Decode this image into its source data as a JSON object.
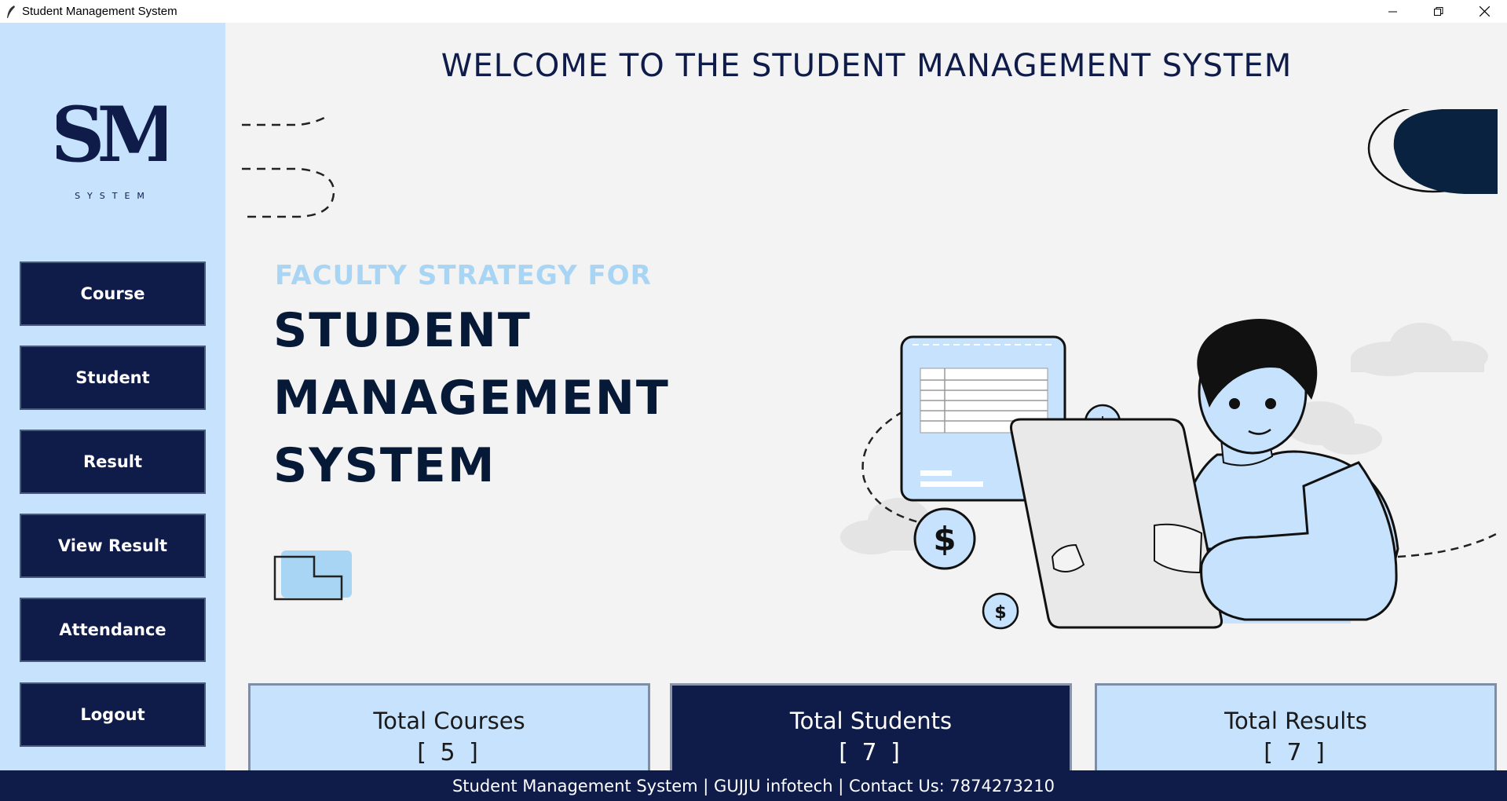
{
  "window": {
    "title": "Student Management System",
    "icon": "feather-icon"
  },
  "sidebar": {
    "logo_text": "SM",
    "logo_subtext": "SYSTEM",
    "buttons": [
      {
        "label": "Course"
      },
      {
        "label": "Student"
      },
      {
        "label": "Result"
      },
      {
        "label": "View Result"
      },
      {
        "label": "Attendance"
      },
      {
        "label": "Logout"
      }
    ]
  },
  "main": {
    "welcome": "WELCOME TO THE STUDENT MANAGEMENT SYSTEM",
    "banner": {
      "subtitle": "FACULTY STRATEGY FOR",
      "line1": "STUDENT",
      "line2": "MANAGEMENT",
      "line3": "SYSTEM",
      "coin_symbol": "$"
    },
    "cards": [
      {
        "label": "Total Courses",
        "count": "[ 5 ]"
      },
      {
        "label": "Total Students",
        "count": "[ 7 ]"
      },
      {
        "label": "Total Results",
        "count": "[ 7 ]"
      }
    ]
  },
  "footer": {
    "text": "Student Management System | GUJJU infotech | Contact Us: 7874273210"
  },
  "colors": {
    "navy": "#0f1c4a",
    "light_blue": "#c6e2fd",
    "accent_blue": "#a8d5f3"
  }
}
